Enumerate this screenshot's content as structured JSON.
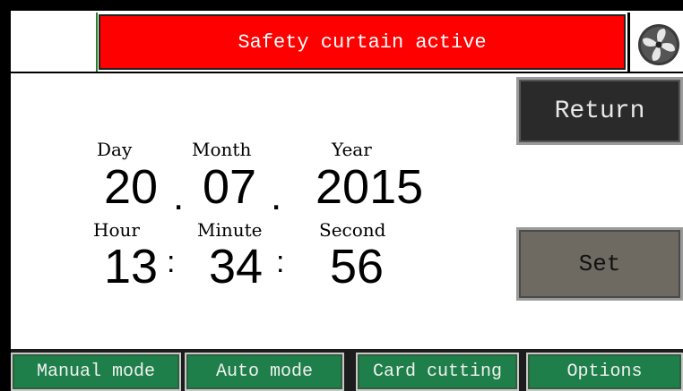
{
  "header": {
    "alarm_text": "Safety curtain active",
    "alarm_color": "#ff0000",
    "fan_icon": "fan-icon"
  },
  "buttons": {
    "return_label": "Return",
    "set_label": "Set"
  },
  "date": {
    "day_label": "Day",
    "month_label": "Month",
    "year_label": "Year",
    "day": "20",
    "month": "07",
    "year": "2015",
    "separator": "."
  },
  "time": {
    "hour_label": "Hour",
    "minute_label": "Minute",
    "second_label": "Second",
    "hour": "13",
    "minute": "34",
    "second": "56",
    "separator": ":"
  },
  "footer": {
    "tabs": [
      {
        "label": "Manual mode"
      },
      {
        "label": "Auto mode"
      },
      {
        "label": "Card cutting"
      },
      {
        "label": "Options"
      }
    ],
    "tab_color": "#1e7f4a"
  }
}
